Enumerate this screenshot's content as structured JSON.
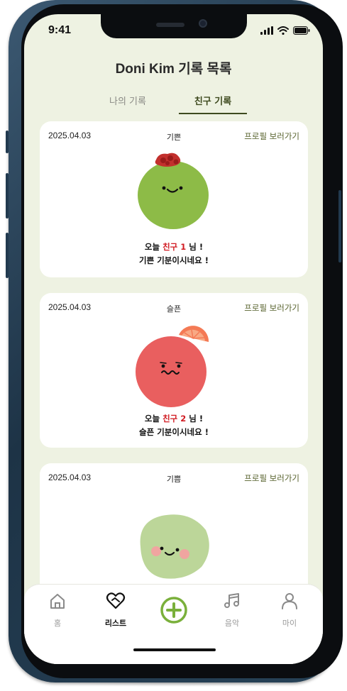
{
  "status_bar": {
    "time": "9:41"
  },
  "header": {
    "title": "Doni Kim 기록 목록"
  },
  "tabs": [
    {
      "label": "나의 기록",
      "active": false
    },
    {
      "label": "친구 기록",
      "active": true
    }
  ],
  "cards": [
    {
      "date": "2025.04.03",
      "mood": "기쁜",
      "profile_link": "프로필 보러가기",
      "character": "green-apple-character",
      "msg_prefix": "오늘 ",
      "friend": "친구 1",
      "msg_suffix": " 님 !",
      "msg_line2": "기쁜 기분이시네요 !"
    },
    {
      "date": "2025.04.03",
      "mood": "슬픈",
      "profile_link": "프로필 보러가기",
      "character": "red-grapefruit-character",
      "msg_prefix": "오늘 ",
      "friend": "친구 2",
      "msg_suffix": " 님 !",
      "msg_line2": "슬픈 기분이시네요 !"
    },
    {
      "date": "2025.04.03",
      "mood": "기쁨",
      "profile_link": "프로필 보러가기",
      "character": "light-green-character"
    }
  ],
  "bottom_nav": {
    "items": [
      {
        "label": "홈",
        "icon": "home-icon",
        "active": false
      },
      {
        "label": "리스트",
        "icon": "heart-list-icon",
        "active": true
      },
      {
        "label": "",
        "icon": "add-icon",
        "active": false
      },
      {
        "label": "음악",
        "icon": "music-icon",
        "active": false
      },
      {
        "label": "마이",
        "icon": "person-icon",
        "active": false
      }
    ]
  },
  "colors": {
    "background": "#eef2e2",
    "accent": "#7ab03b",
    "friend_name": "#d11b22",
    "profile_link": "#55602a"
  }
}
